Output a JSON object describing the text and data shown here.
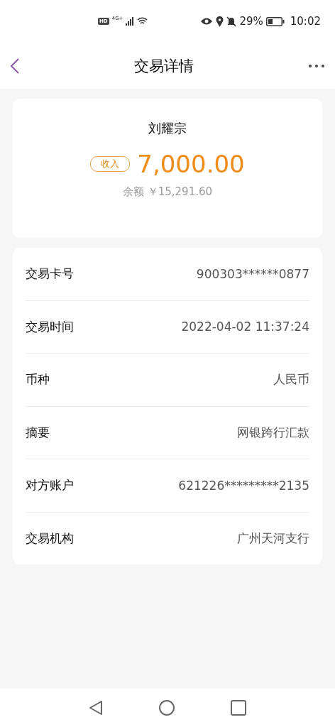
{
  "status_bar": {
    "hd": "HD",
    "network": "4G+",
    "battery": "29%",
    "time": "10:02"
  },
  "header": {
    "title": "交易详情"
  },
  "summary": {
    "name": "刘耀宗",
    "tag": "收入",
    "amount": "7,000.00",
    "balance_label": "余额",
    "balance": "￥15,291.60"
  },
  "details": [
    {
      "label": "交易卡号",
      "value": "900303******0877"
    },
    {
      "label": "交易时间",
      "value": "2022-04-02 11:37:24"
    },
    {
      "label": "币种",
      "value": "人民币"
    },
    {
      "label": "摘要",
      "value": "网银跨行汇款"
    },
    {
      "label": "对方账户",
      "value": "621226*********2135"
    },
    {
      "label": "交易机构",
      "value": "广州天河支行"
    }
  ]
}
